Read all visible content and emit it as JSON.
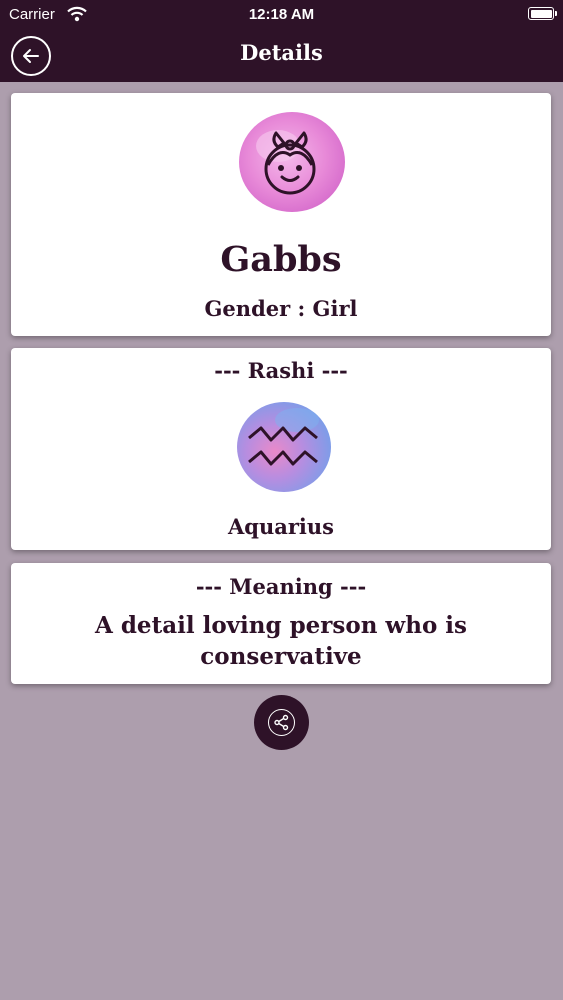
{
  "status_bar": {
    "carrier": "Carrier",
    "time": "12:18 AM"
  },
  "nav": {
    "title": "Details",
    "back_icon": "back-arrow-icon"
  },
  "profile": {
    "avatar_icon": "girl-face-icon",
    "name": "Gabbs",
    "gender": "Gender : Girl"
  },
  "rashi": {
    "heading": "--- Rashi ---",
    "icon": "aquarius-icon",
    "name": "Aquarius"
  },
  "meaning": {
    "heading": "--- Meaning ---",
    "text": "A detail loving person who is conservative"
  },
  "share": {
    "icon": "share-icon"
  },
  "colors": {
    "primary": "#2e1228",
    "background": "#ad9ead",
    "card": "#ffffff",
    "avatar_pink": "#e88ad8",
    "rashi_blue": "#9a7be0"
  }
}
